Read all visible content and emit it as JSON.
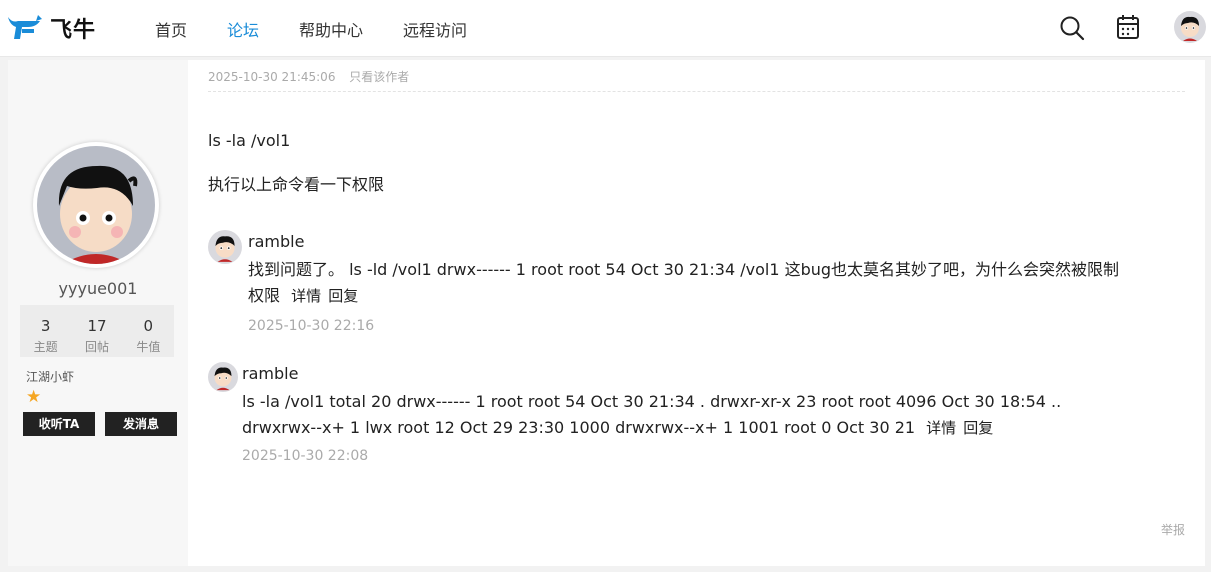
{
  "header": {
    "brand": "飞牛",
    "nav": [
      "首页",
      "论坛",
      "帮助中心",
      "远程访问"
    ],
    "active_nav": "论坛"
  },
  "profile": {
    "username": "yyyue001",
    "stats": [
      {
        "value": "3",
        "label": "主题"
      },
      {
        "value": "17",
        "label": "回帖"
      },
      {
        "value": "0",
        "label": "牛值"
      }
    ],
    "rank": "江湖小虾",
    "follow_label": "收听TA",
    "message_label": "发消息"
  },
  "post": {
    "timestamp": "2025-10-30 21:45:06",
    "only_author": "只看该作者",
    "lines": [
      "ls -la /vol1",
      "执行以上命令看一下权限"
    ],
    "report_label": "举报"
  },
  "replies": [
    {
      "author": "ramble",
      "text_line1": "找到问题了。 ls -ld /vol1 drwx------ 1 root root 54 Oct 30 21:34 /vol1 这bug也太莫名其妙了吧，为什么会突然被限制",
      "text_line2": "权限",
      "detail_label": "详情",
      "reply_label": "回复",
      "time": "2025-10-30 22:16"
    },
    {
      "author": "ramble",
      "text_line1": "ls -la /vol1 total 20 drwx------ 1 root root 54 Oct 30 21:34 . drwxr-xr-x 23 root root 4096 Oct 30 18:54 ..",
      "text_line2": "drwxrwx--x+ 1 lwx root 12 Oct 29 23:30 1000 drwxrwx--x+ 1 1001 root 0 Oct 30 21",
      "detail_label": "详情",
      "reply_label": "回复",
      "time": "2025-10-30 22:08"
    }
  ],
  "colors": {
    "accent": "#1a8cd8",
    "star": "#f5a623",
    "button": "#222222"
  }
}
